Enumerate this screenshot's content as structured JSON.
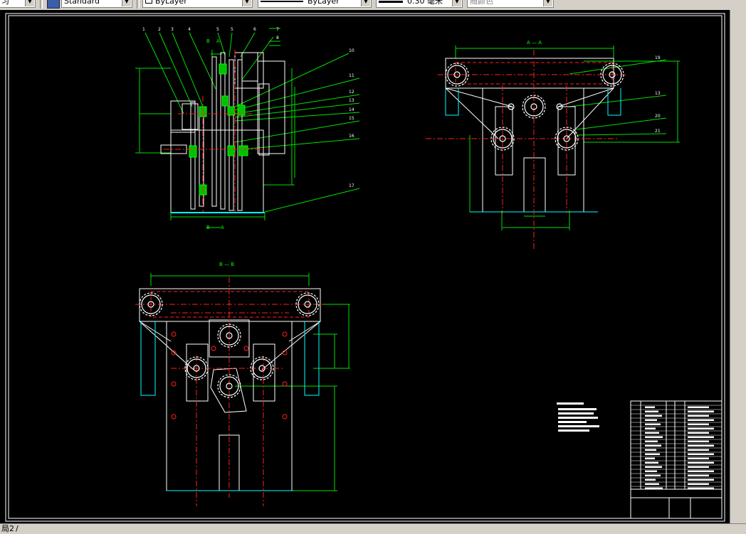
{
  "toolbar": {
    "textstyle_value": "Standard",
    "layer_value": "ByLayer",
    "linetype_value": "ByLayer",
    "lineweight_value": "0.30 毫米",
    "color_value": "随颜色"
  },
  "drawing": {
    "section_aa": "A — A",
    "section_bb": "B — B",
    "label_b_top": "B",
    "label_a_top": "A",
    "label_b_bottom": "B",
    "label_a_bottom": "A",
    "balloons": [
      "1",
      "2",
      "3",
      "4",
      "5",
      "6",
      "7",
      "8",
      "10",
      "11",
      "12",
      "13",
      "14",
      "15",
      "16",
      "17",
      "19",
      "13",
      "20",
      "21"
    ]
  },
  "status": {
    "layout_tab": "局2"
  },
  "colors": {
    "background": "#000000",
    "outline": "#ffffff",
    "center": "#ff2020",
    "dimension": "#00e000",
    "hidden": "#00ffff"
  }
}
